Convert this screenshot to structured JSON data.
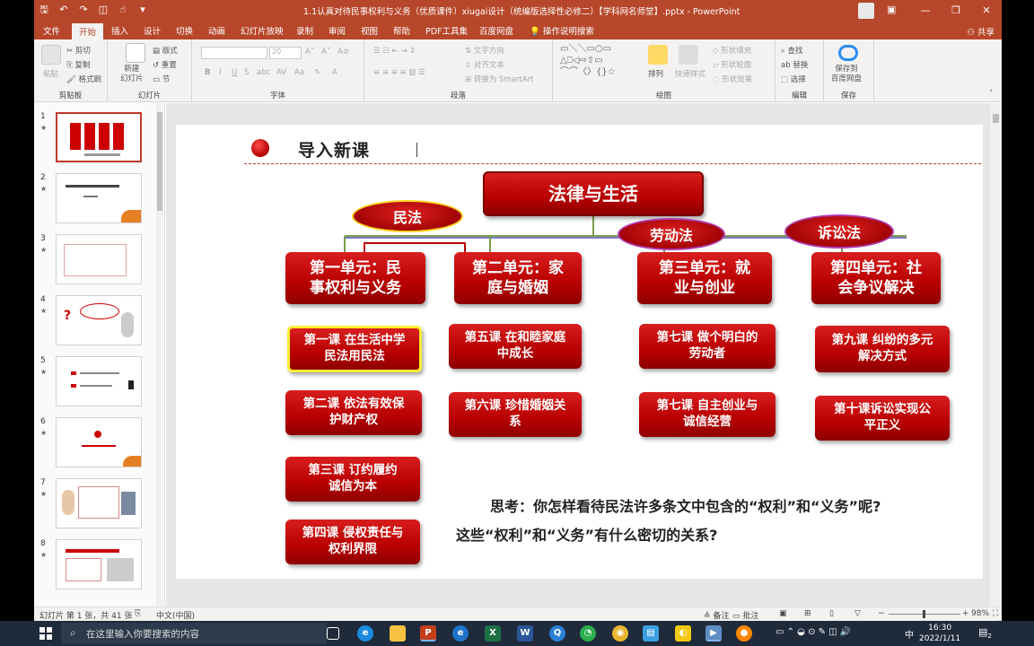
{
  "window": {
    "title": "1.1认真对待民事权利与义务（优质课件）xiugai设计（统编版选择性必修二）【学科网名师堂】.pptx - PowerPoint",
    "controls": [
      "—",
      "❐",
      "✕"
    ]
  },
  "tabs": [
    "文件",
    "开始",
    "插入",
    "设计",
    "切换",
    "动画",
    "幻灯片放映",
    "录制",
    "审阅",
    "视图",
    "帮助",
    "PDF工具集",
    "百度网盘",
    "操作说明搜索"
  ],
  "active_tab": "开始",
  "share_label": "共享",
  "ribbon": {
    "clipboard": {
      "label": "剪贴板",
      "paste": "粘贴",
      "cut": "剪切",
      "copy": "复制",
      "format_painter": "格式刷"
    },
    "slides": {
      "label": "幻灯片",
      "new_slide": "新建\n幻灯片",
      "layout": "版式",
      "reset": "重置",
      "section": "节"
    },
    "font": {
      "label": "字体",
      "size": "20"
    },
    "paragraph": {
      "label": "段落",
      "text_direction": "文字方向",
      "align_text": "对齐文本",
      "smartart": "转换为 SmartArt"
    },
    "drawing": {
      "label": "绘图",
      "arrange": "排列",
      "quick_styles": "快速样式",
      "shape_fill": "形状填充",
      "shape_outline": "形状轮廓",
      "shape_effects": "形状效果"
    },
    "editing": {
      "label": "编辑",
      "find": "查找",
      "replace": "替换",
      "select": "选择"
    },
    "save": {
      "label": "保存",
      "button": "保存到\n百度网盘"
    }
  },
  "thumbnails": [
    {
      "num": "1",
      "star": "★"
    },
    {
      "num": "2",
      "star": "★"
    },
    {
      "num": "3",
      "star": "★"
    },
    {
      "num": "4",
      "star": "★"
    },
    {
      "num": "5",
      "star": "★"
    },
    {
      "num": "6",
      "star": "★"
    },
    {
      "num": "7",
      "star": "★"
    },
    {
      "num": "8",
      "star": "★"
    }
  ],
  "slide": {
    "heading": "导入新课",
    "main": "法律与生活",
    "categories": [
      "民法",
      "劳动法",
      "诉讼法"
    ],
    "units": [
      "第一单元：民\n事权利与义务",
      "第二单元：家\n庭与婚姻",
      "第三单元：就\n业与创业",
      "第四单元：社\n会争议解决"
    ],
    "lessons": {
      "col1": [
        "第一课 在生活中学\n民法用民法",
        "第二课 依法有效保\n护财产权",
        "第三课 订约履约\n诚信为本",
        "第四课 侵权责任与\n权利界限"
      ],
      "col2": [
        "第五课 在和睦家庭\n中成长",
        "第六课 珍惜婚姻关\n系"
      ],
      "col3": [
        "第七课 做个明白的\n劳动者",
        "第七课 自主创业与\n诚信经营"
      ],
      "col4": [
        "第九课 纠纷的多元\n解决方式",
        "第十课诉讼实现公\n平正义"
      ]
    },
    "think_line1": "思考：你怎样看待民法许多条文中包含的“权利”和“义务”呢?",
    "think_line2": "这些“权利”和“义务”有什么密切的关系?"
  },
  "statusbar": {
    "slide_info": "幻灯片 第 1 张，共 41 张",
    "language": "中文(中国)",
    "notes": "备注",
    "comments": "批注",
    "zoom": "98%"
  },
  "taskbar": {
    "search_placeholder": "在这里输入你要搜索的内容",
    "time": "16:30",
    "date": "2022/1/11",
    "ime": "中",
    "notif_count": "2"
  },
  "colors": {
    "accent": "#b7472a",
    "slide_red": "#c00000",
    "highlight": "#ffee33"
  }
}
